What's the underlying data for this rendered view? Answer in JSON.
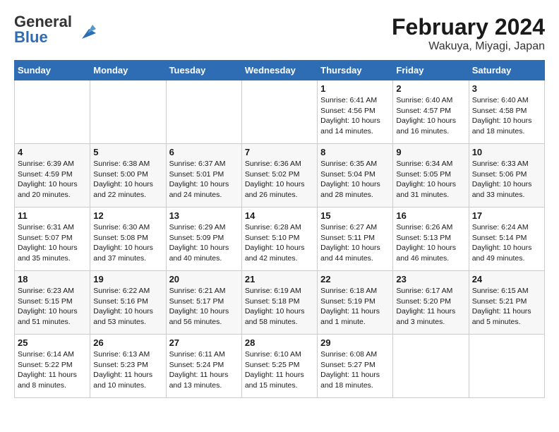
{
  "header": {
    "logo": {
      "general": "General",
      "blue": "Blue"
    },
    "title": "February 2024",
    "subtitle": "Wakuya, Miyagi, Japan"
  },
  "columns": [
    "Sunday",
    "Monday",
    "Tuesday",
    "Wednesday",
    "Thursday",
    "Friday",
    "Saturday"
  ],
  "weeks": [
    [
      {
        "day": "",
        "info": ""
      },
      {
        "day": "",
        "info": ""
      },
      {
        "day": "",
        "info": ""
      },
      {
        "day": "",
        "info": ""
      },
      {
        "day": "1",
        "info": "Sunrise: 6:41 AM\nSunset: 4:56 PM\nDaylight: 10 hours\nand 14 minutes."
      },
      {
        "day": "2",
        "info": "Sunrise: 6:40 AM\nSunset: 4:57 PM\nDaylight: 10 hours\nand 16 minutes."
      },
      {
        "day": "3",
        "info": "Sunrise: 6:40 AM\nSunset: 4:58 PM\nDaylight: 10 hours\nand 18 minutes."
      }
    ],
    [
      {
        "day": "4",
        "info": "Sunrise: 6:39 AM\nSunset: 4:59 PM\nDaylight: 10 hours\nand 20 minutes."
      },
      {
        "day": "5",
        "info": "Sunrise: 6:38 AM\nSunset: 5:00 PM\nDaylight: 10 hours\nand 22 minutes."
      },
      {
        "day": "6",
        "info": "Sunrise: 6:37 AM\nSunset: 5:01 PM\nDaylight: 10 hours\nand 24 minutes."
      },
      {
        "day": "7",
        "info": "Sunrise: 6:36 AM\nSunset: 5:02 PM\nDaylight: 10 hours\nand 26 minutes."
      },
      {
        "day": "8",
        "info": "Sunrise: 6:35 AM\nSunset: 5:04 PM\nDaylight: 10 hours\nand 28 minutes."
      },
      {
        "day": "9",
        "info": "Sunrise: 6:34 AM\nSunset: 5:05 PM\nDaylight: 10 hours\nand 31 minutes."
      },
      {
        "day": "10",
        "info": "Sunrise: 6:33 AM\nSunset: 5:06 PM\nDaylight: 10 hours\nand 33 minutes."
      }
    ],
    [
      {
        "day": "11",
        "info": "Sunrise: 6:31 AM\nSunset: 5:07 PM\nDaylight: 10 hours\nand 35 minutes."
      },
      {
        "day": "12",
        "info": "Sunrise: 6:30 AM\nSunset: 5:08 PM\nDaylight: 10 hours\nand 37 minutes."
      },
      {
        "day": "13",
        "info": "Sunrise: 6:29 AM\nSunset: 5:09 PM\nDaylight: 10 hours\nand 40 minutes."
      },
      {
        "day": "14",
        "info": "Sunrise: 6:28 AM\nSunset: 5:10 PM\nDaylight: 10 hours\nand 42 minutes."
      },
      {
        "day": "15",
        "info": "Sunrise: 6:27 AM\nSunset: 5:11 PM\nDaylight: 10 hours\nand 44 minutes."
      },
      {
        "day": "16",
        "info": "Sunrise: 6:26 AM\nSunset: 5:13 PM\nDaylight: 10 hours\nand 46 minutes."
      },
      {
        "day": "17",
        "info": "Sunrise: 6:24 AM\nSunset: 5:14 PM\nDaylight: 10 hours\nand 49 minutes."
      }
    ],
    [
      {
        "day": "18",
        "info": "Sunrise: 6:23 AM\nSunset: 5:15 PM\nDaylight: 10 hours\nand 51 minutes."
      },
      {
        "day": "19",
        "info": "Sunrise: 6:22 AM\nSunset: 5:16 PM\nDaylight: 10 hours\nand 53 minutes."
      },
      {
        "day": "20",
        "info": "Sunrise: 6:21 AM\nSunset: 5:17 PM\nDaylight: 10 hours\nand 56 minutes."
      },
      {
        "day": "21",
        "info": "Sunrise: 6:19 AM\nSunset: 5:18 PM\nDaylight: 10 hours\nand 58 minutes."
      },
      {
        "day": "22",
        "info": "Sunrise: 6:18 AM\nSunset: 5:19 PM\nDaylight: 11 hours\nand 1 minute."
      },
      {
        "day": "23",
        "info": "Sunrise: 6:17 AM\nSunset: 5:20 PM\nDaylight: 11 hours\nand 3 minutes."
      },
      {
        "day": "24",
        "info": "Sunrise: 6:15 AM\nSunset: 5:21 PM\nDaylight: 11 hours\nand 5 minutes."
      }
    ],
    [
      {
        "day": "25",
        "info": "Sunrise: 6:14 AM\nSunset: 5:22 PM\nDaylight: 11 hours\nand 8 minutes."
      },
      {
        "day": "26",
        "info": "Sunrise: 6:13 AM\nSunset: 5:23 PM\nDaylight: 11 hours\nand 10 minutes."
      },
      {
        "day": "27",
        "info": "Sunrise: 6:11 AM\nSunset: 5:24 PM\nDaylight: 11 hours\nand 13 minutes."
      },
      {
        "day": "28",
        "info": "Sunrise: 6:10 AM\nSunset: 5:25 PM\nDaylight: 11 hours\nand 15 minutes."
      },
      {
        "day": "29",
        "info": "Sunrise: 6:08 AM\nSunset: 5:27 PM\nDaylight: 11 hours\nand 18 minutes."
      },
      {
        "day": "",
        "info": ""
      },
      {
        "day": "",
        "info": ""
      }
    ]
  ]
}
